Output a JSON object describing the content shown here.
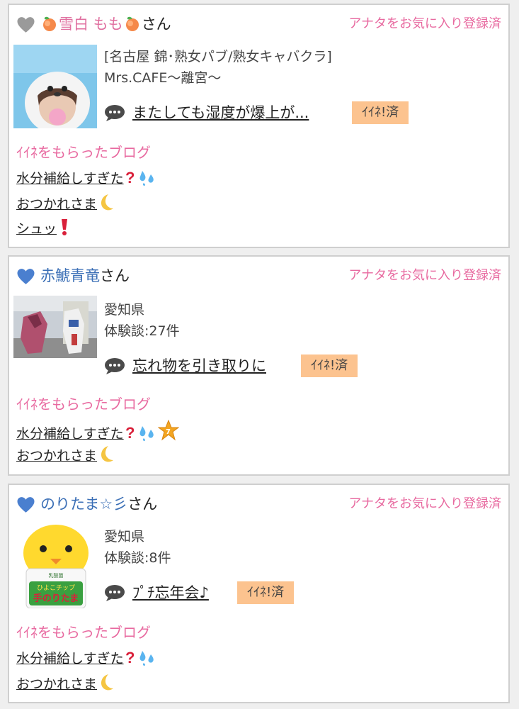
{
  "cards": [
    {
      "name_parts": [
        "雪白 もも"
      ],
      "suffix": "さん",
      "fav_label": "アナタをお気に入り登録済",
      "meta_lines": [
        "[名古屋 錦･熟女パブ/熟女キャバクラ]",
        "Mrs.CAFE～離宮～"
      ],
      "post_title": "またしても湿度が爆上が...",
      "iine_label": "ｲｲﾈ!済",
      "blog_heading": "ｲｲﾈをもらったブログ",
      "blogs": [
        "水分補給しすぎた",
        "おつかれさま",
        "シュッ"
      ]
    },
    {
      "name": "赤鯱青竜",
      "suffix": "さん",
      "fav_label": "アナタをお気に入り登録済",
      "meta_lines": [
        "愛知県",
        "体験談:27件"
      ],
      "post_title": "忘れ物を引き取りに",
      "iine_label": "ｲｲﾈ!済",
      "blog_heading": "ｲｲﾈをもらったブログ",
      "blogs": [
        "水分補給しすぎた",
        "おつかれさま"
      ]
    },
    {
      "name": "のりたま☆彡",
      "suffix": "さん",
      "fav_label": "アナタをお気に入り登録済",
      "meta_lines": [
        "愛知県",
        "体験談:8件"
      ],
      "post_title": "ﾌﾟﾁ忘年会♪",
      "iine_label": "ｲｲﾈ!済",
      "blog_heading": "ｲｲﾈをもらったブログ",
      "blogs": [
        "水分補給しすぎた",
        "おつかれさま"
      ],
      "thumb_text": [
        "ひよこチップ",
        "手のりたま",
        "乳酸菌"
      ]
    }
  ],
  "colors": {
    "pink": "#e86aa0",
    "blue_heart": "#4a7fcf",
    "gray_heart": "#9a9a9a",
    "iine_bg": "#fcc38f"
  }
}
